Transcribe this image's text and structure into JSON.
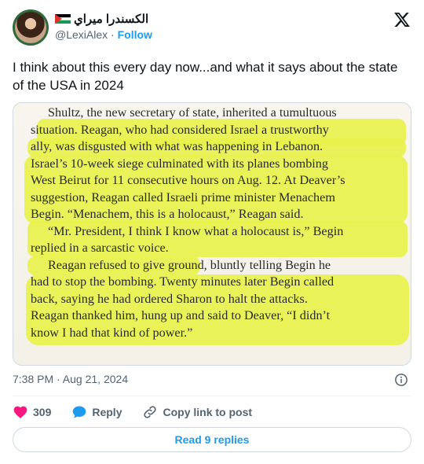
{
  "author": {
    "display_name": "الكسندرا ميراي",
    "handle": "@LexiAlex",
    "separator": "·",
    "follow_label": "Follow"
  },
  "tweet": {
    "text": "I think about this every day now...and what it says about the state of the USA in 2024",
    "timestamp": "7:38 PM · Aug 21, 2024"
  },
  "image_text": {
    "lines": [
      "Shultz, the new secretary of state, inherited a tumultuous",
      "situation. Reagan, who had considered Israel a trustworthy",
      "ally, was disgusted with what was happening in Lebanon.",
      "Israel’s 10-week siege culminated with its planes bombing",
      "West Beirut for 11 consecutive hours on Aug. 12. At Deaver’s",
      "suggestion, Reagan called Israeli prime minister Menachem",
      "Begin. “Menachem, this is a holocaust,” Reagan said.",
      "“Mr. President, I think I know what a holocaust is,” Begin",
      "replied in a sarcastic voice.",
      "Reagan refused to give ground, bluntly telling Begin he",
      "had to stop the bombing. Twenty minutes later Begin called",
      "back, saying he had ordered Sharon to halt the attacks.",
      "Reagan thanked him, hung up and said to Deaver, “I didn’t",
      "know I had that kind of power.”"
    ],
    "highlight_color": "#e9f24a"
  },
  "actions": {
    "like_count": "309",
    "reply_label": "Reply",
    "copy_label": "Copy link to post"
  },
  "footer": {
    "read_replies_label": "Read 9 replies"
  },
  "icons": {
    "like": "heart-icon",
    "reply": "speech-bubble-icon",
    "copy": "link-icon",
    "info": "info-icon",
    "brand": "x-logo-icon"
  },
  "colors": {
    "accent": "#1d9bf0",
    "like": "#f91880",
    "muted_text": "#536471"
  }
}
